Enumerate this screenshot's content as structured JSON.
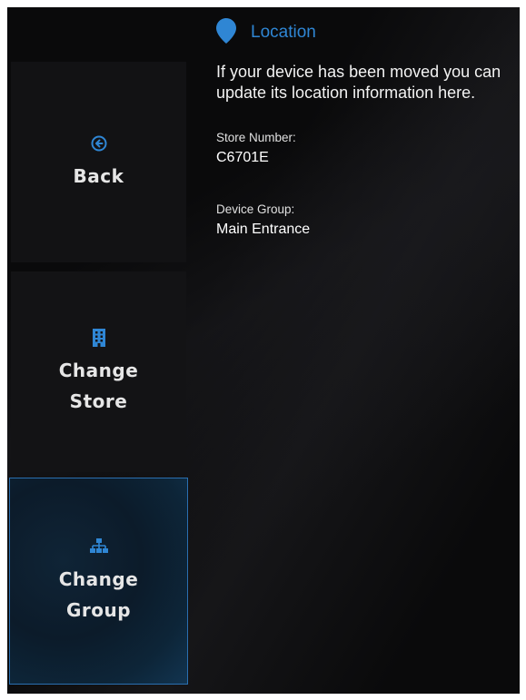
{
  "header": {
    "title": "Location",
    "icon": "map-pin-icon",
    "accent_color": "#2f86d4"
  },
  "description": "If your device has been moved you can update its location information here.",
  "fields": [
    {
      "label": "Store Number:",
      "value": "C6701E"
    },
    {
      "label": "Device Group:",
      "value": "Main Entrance"
    }
  ],
  "sidebar": {
    "items": [
      {
        "label_line1": "Back",
        "label_line2": "",
        "icon": "back-arrow-circle-icon",
        "selected": false
      },
      {
        "label_line1": "Change",
        "label_line2": "Store",
        "icon": "building-icon",
        "selected": false
      },
      {
        "label_line1": "Change",
        "label_line2": "Group",
        "icon": "org-hierarchy-icon",
        "selected": true
      }
    ]
  }
}
